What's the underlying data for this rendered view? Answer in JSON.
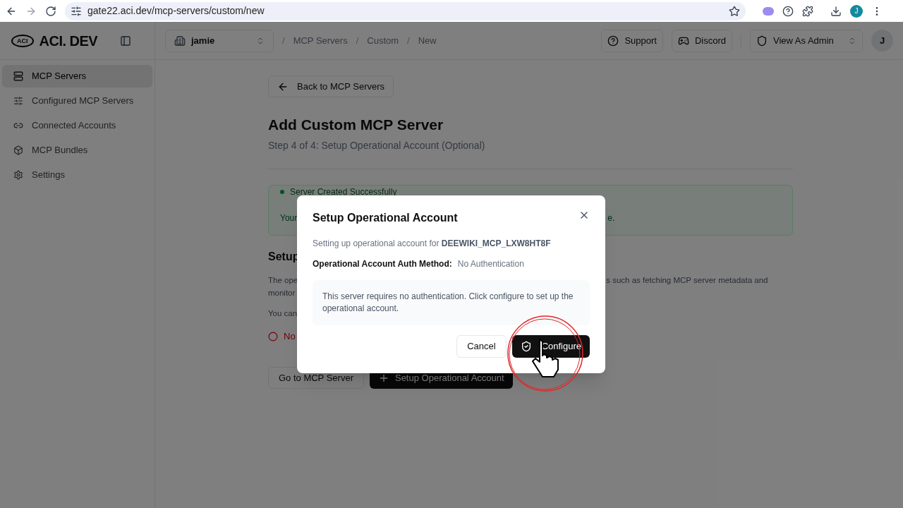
{
  "browser": {
    "url": "gate22.aci.dev/mcp-servers/custom/new",
    "profile_initial": "J"
  },
  "header": {
    "logo_mark": "ACI",
    "logo_text": "ACI. DEV",
    "org": "jamie",
    "breadcrumbs": [
      {
        "separator": "/",
        "label": "MCP Servers"
      },
      {
        "separator": "/",
        "label": "Custom"
      },
      {
        "separator": "/",
        "label": "New"
      }
    ],
    "support": "Support",
    "discord": "Discord",
    "role": "View As Admin",
    "avatar": "J"
  },
  "sidebar": {
    "items": [
      {
        "label": "MCP Servers",
        "selected": true
      },
      {
        "label": "Configured MCP Servers",
        "selected": false
      },
      {
        "label": "Connected Accounts",
        "selected": false
      },
      {
        "label": "MCP Bundles",
        "selected": false
      },
      {
        "label": "Settings",
        "selected": false
      }
    ]
  },
  "page": {
    "back_button": "Back to MCP Servers",
    "title": "Add Custom MCP Server",
    "subtitle": "Step 4 of 4: Setup Operational Account (Optional)",
    "alert": {
      "title": "Server Created Successfully",
      "text_left": "Your",
      "text_right": "e."
    },
    "section_title": "Setup",
    "paragraph_lines": [
      {
        "left": "The ope",
        "right": "s such as fetching MCP server metadata and"
      },
      {
        "left": "monitor"
      }
    ],
    "note": "You can",
    "status": "No",
    "buttons": {
      "secondary": "Go to MCP Server",
      "primary": "Setup Operational Account"
    }
  },
  "dialog": {
    "title": "Setup Operational Account",
    "intro": "Setting up operational account for",
    "server_name": "DEEWIKI_MCP_LXW8HT8F",
    "auth_label": "Operational Account Auth Method:",
    "auth_value": "No Authentication",
    "info": "This server requires no authentication. Click configure to set up the operational account.",
    "cancel": "Cancel",
    "confirm": "Configure"
  }
}
